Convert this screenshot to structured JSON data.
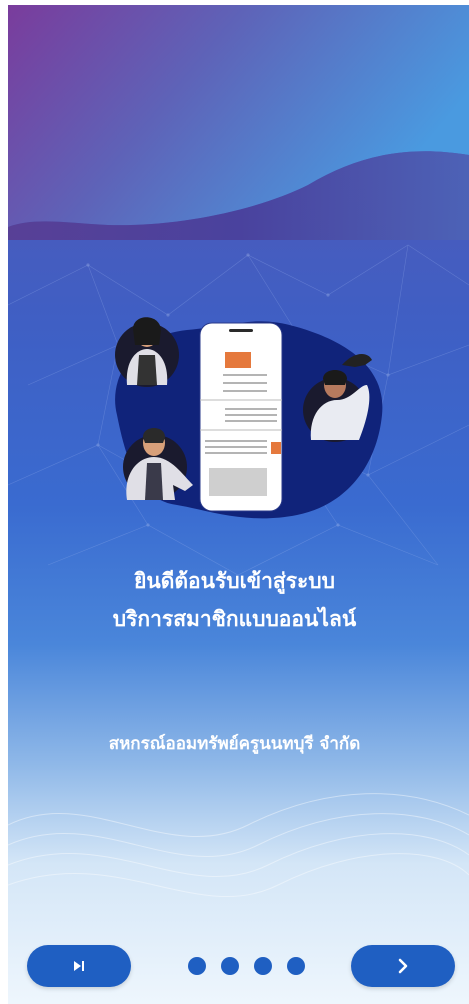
{
  "welcome": {
    "line1": "ยินดีต้อนรับเข้าสู่ระบบ",
    "line2": "บริการสมาชิกแบบออนไลน์"
  },
  "organization": {
    "name": "สหกรณ์ออมทรัพย์ครูนนทบุรี จำกัด"
  },
  "controls": {
    "skip_icon": "skip-to-end-icon",
    "next_icon": "chevron-right-icon",
    "page_count": 4
  },
  "colors": {
    "primary_button": "#1f5fc2",
    "text": "#ffffff"
  }
}
